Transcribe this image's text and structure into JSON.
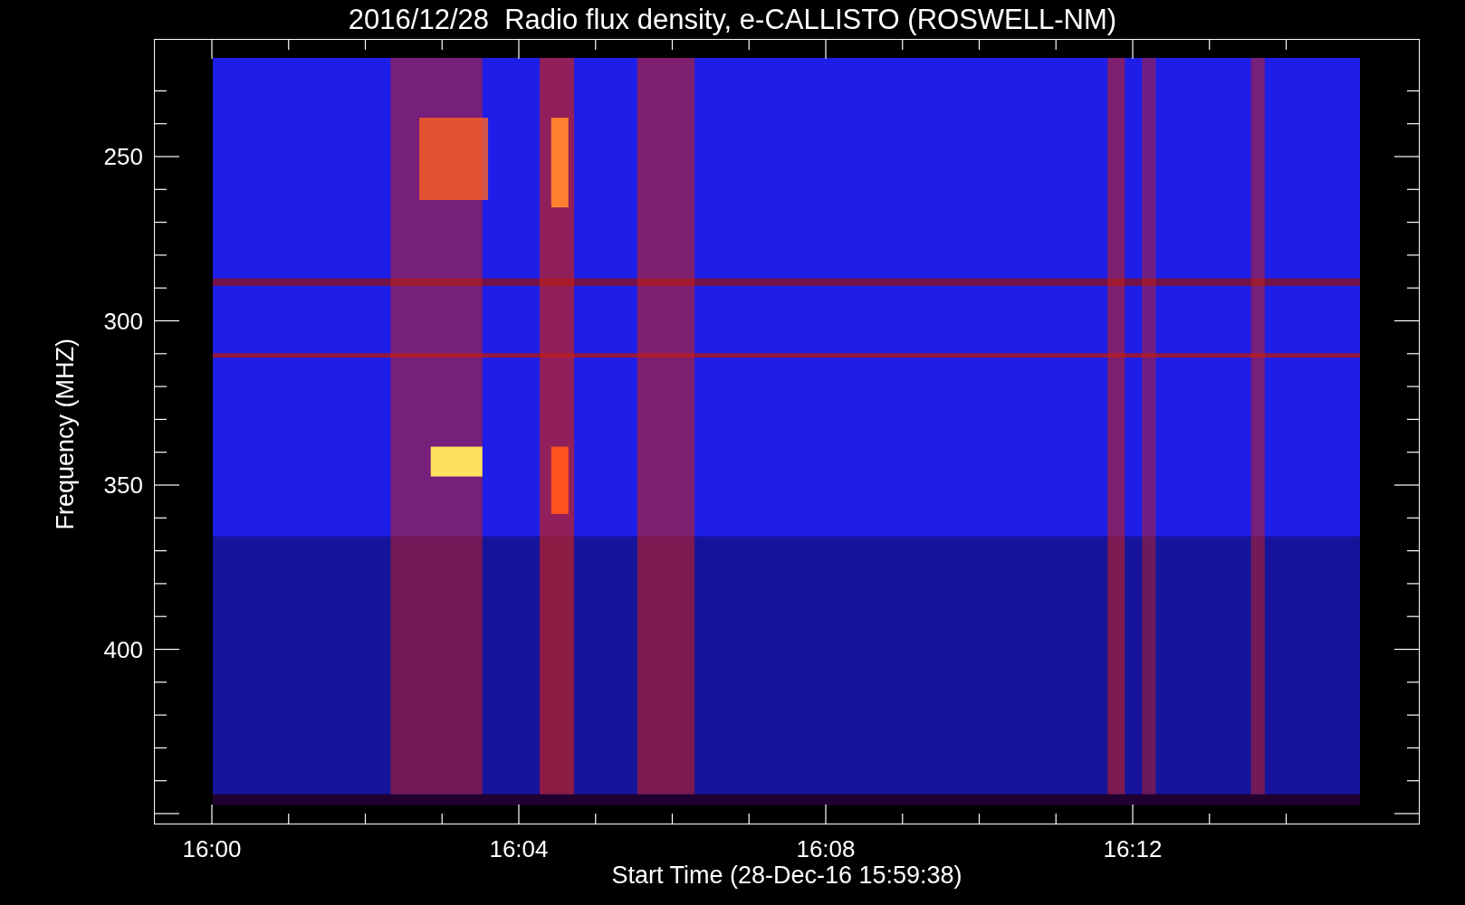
{
  "title": "2016/12/28  Radio flux density, e-CALLISTO (ROSWELL-NM)",
  "y_axis": {
    "label": "Frequency (MHZ)",
    "ticks": [
      "250",
      "300",
      "350",
      "400"
    ]
  },
  "x_axis": {
    "label": "Start Time (28-Dec-16 15:59:38)",
    "ticks": [
      "16:00",
      "16:04",
      "16:08",
      "16:12"
    ]
  }
}
